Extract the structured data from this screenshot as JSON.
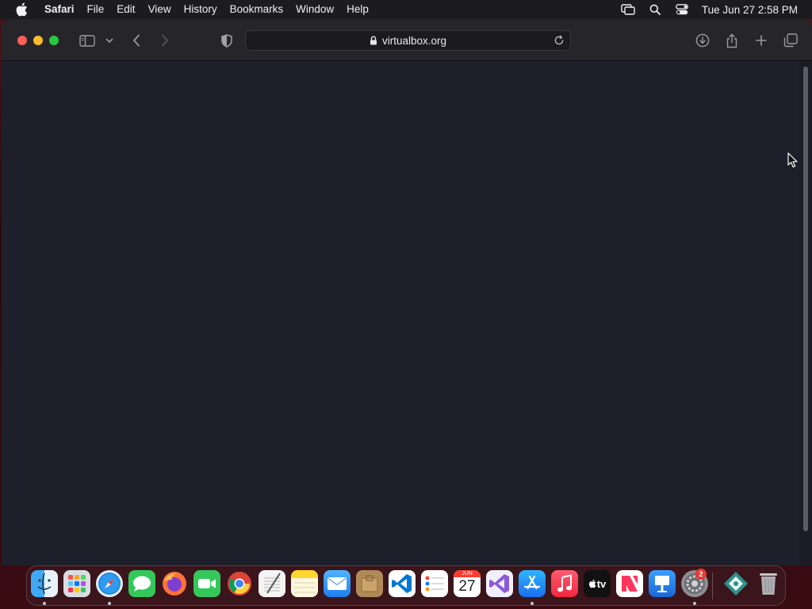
{
  "menubar": {
    "app_name": "Safari",
    "items": [
      "File",
      "Edit",
      "View",
      "History",
      "Bookmarks",
      "Window",
      "Help"
    ],
    "status_icons": [
      "screen-mirroring-icon",
      "spotlight-search-icon",
      "control-center-icon"
    ],
    "clock": "Tue Jun 27  2:58 PM"
  },
  "browser": {
    "url": "virtualbox.org",
    "toolbar_icons": [
      "sidebar-toggle-icon",
      "chevron-down-icon",
      "back-icon",
      "forward-icon",
      "privacy-shield-icon",
      "download-icon",
      "share-icon",
      "new-tab-icon",
      "tab-overview-icon"
    ]
  },
  "dock": {
    "apps": [
      {
        "name": "Finder",
        "icon": "finder-icon",
        "running": true
      },
      {
        "name": "Launchpad",
        "icon": "launchpad-icon",
        "running": false
      },
      {
        "name": "Safari",
        "icon": "safari-icon",
        "running": true
      },
      {
        "name": "Messages",
        "icon": "messages-icon",
        "running": false
      },
      {
        "name": "Firefox",
        "icon": "firefox-icon",
        "running": false
      },
      {
        "name": "FaceTime",
        "icon": "facetime-icon",
        "running": false
      },
      {
        "name": "Chrome",
        "icon": "chrome-icon",
        "running": false
      },
      {
        "name": "TextEdit",
        "icon": "textedit-icon",
        "running": false
      },
      {
        "name": "Notes",
        "icon": "notes-icon",
        "running": false
      },
      {
        "name": "Mail",
        "icon": "mail-icon",
        "running": false
      },
      {
        "name": "Archive",
        "icon": "archive-icon",
        "running": false
      },
      {
        "name": "VS Code",
        "icon": "vscode-icon",
        "running": false
      },
      {
        "name": "Reminders",
        "icon": "reminders-icon",
        "running": false
      },
      {
        "name": "Calendar",
        "icon": "calendar-icon",
        "running": false,
        "month": "JUN",
        "day": "27"
      },
      {
        "name": "Visual Studio",
        "icon": "visual-studio-icon",
        "running": false
      },
      {
        "name": "App Store",
        "icon": "app-store-icon",
        "running": true
      },
      {
        "name": "Music",
        "icon": "music-icon",
        "running": false
      },
      {
        "name": "TV",
        "icon": "apple-tv-icon",
        "running": false,
        "label": "tv"
      },
      {
        "name": "News",
        "icon": "news-icon",
        "running": false
      },
      {
        "name": "Keynote",
        "icon": "keynote-icon",
        "running": false
      },
      {
        "name": "System Settings",
        "icon": "system-settings-icon",
        "running": true,
        "badge": "2"
      }
    ],
    "extras": [
      {
        "name": "Downloads",
        "icon": "downloads-stack-icon"
      },
      {
        "name": "Trash",
        "icon": "trash-icon"
      }
    ]
  },
  "colors": {
    "menubar": "#1c1c1e",
    "toolbar": "#26262a",
    "page_background": "#1d1f2a",
    "accent": "#0a84ff"
  }
}
